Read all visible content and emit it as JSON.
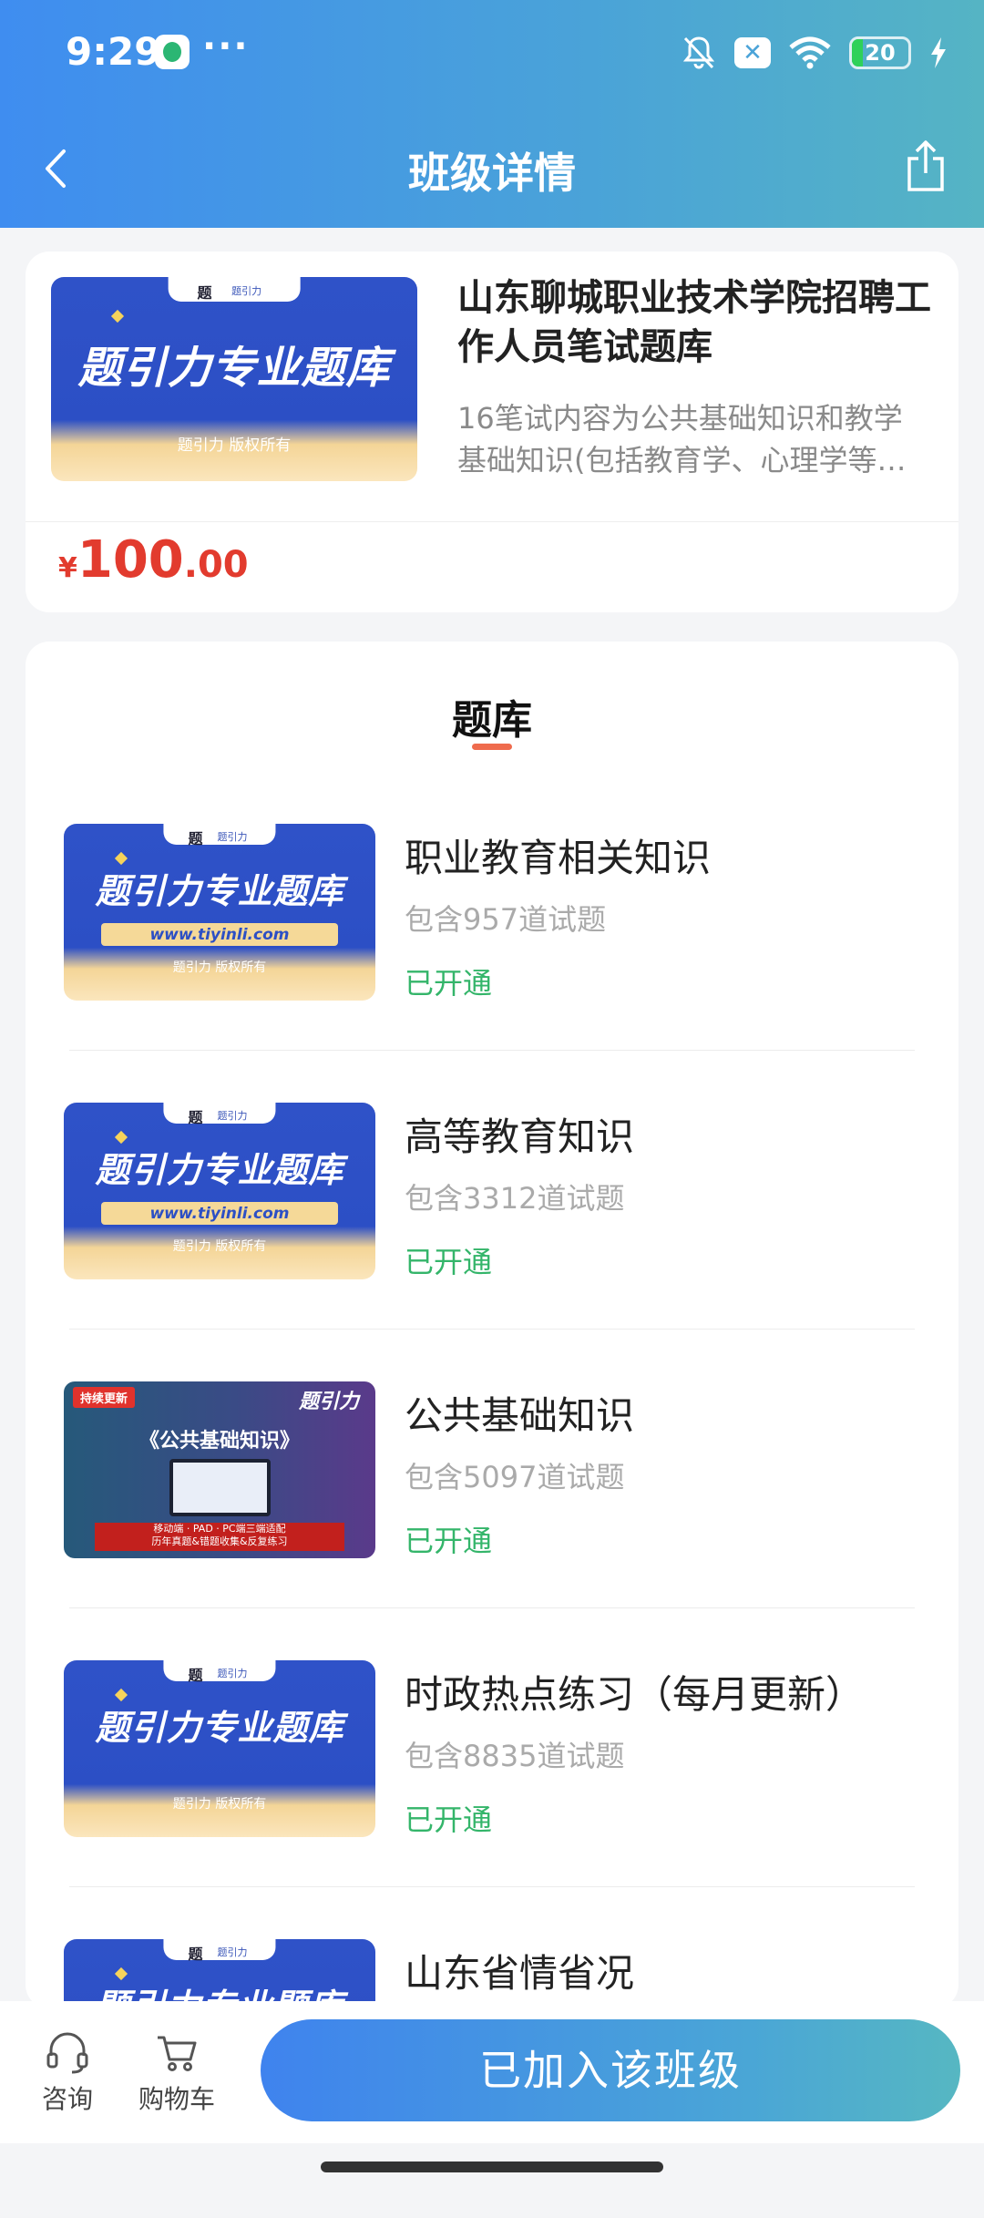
{
  "status_bar": {
    "time": "9:29",
    "dots": "···",
    "battery": "20",
    "x_badge": "✕"
  },
  "nav": {
    "title": "班级详情"
  },
  "class_info": {
    "title": "山东聊城职业技术学院招聘工作人员笔试题库",
    "description": "16笔试内容为公共基础知识和教学基础知识(包括教育学、心理学等…",
    "cover": {
      "main_text": "题引力专业题库",
      "copyright": "题引力 版权所有"
    },
    "price": {
      "symbol": "¥",
      "integer": "100",
      "decimal": ".00"
    }
  },
  "bank_section": {
    "tab_label": "题库",
    "items": [
      {
        "name": "职业教育相关知识",
        "count": "包含957道试题",
        "status": "已开通",
        "thumb": {
          "main_text": "题引力专业题库",
          "url": "www.tiyinli.com",
          "copyright": "题引力 版权所有"
        }
      },
      {
        "name": "高等教育知识",
        "count": "包含3312道试题",
        "status": "已开通",
        "thumb": {
          "main_text": "题引力专业题库",
          "url": "www.tiyinli.com",
          "copyright": "题引力 版权所有"
        }
      },
      {
        "name": "公共基础知识",
        "count": "包含5097道试题",
        "status": "已开通",
        "thumb": {
          "badge": "持续更新",
          "title": "《公共基础知识》",
          "logo": "题引力",
          "bar_line1": "移动端 · PAD · PC端三端适配",
          "bar_line2": "历年真题&错题收集&反复练习"
        }
      },
      {
        "name": "时政热点练习（每月更新）",
        "count": "包含8835道试题",
        "status": "已开通",
        "thumb": {
          "main_text": "题引力专业题库",
          "copyright": "题引力 版权所有"
        }
      },
      {
        "name": "山东省情省况",
        "count": "",
        "status": "",
        "thumb": {
          "main_text": "题引力专业题库",
          "copyright": ""
        }
      }
    ]
  },
  "bottom_bar": {
    "consult_label": "咨询",
    "cart_label": "购物车",
    "join_label": "已加入该班级"
  },
  "colors": {
    "accent_blue": "#3f8df0",
    "price_red": "#e23b2e",
    "status_green": "#34b56a",
    "tab_underline": "#ef6b4d"
  }
}
